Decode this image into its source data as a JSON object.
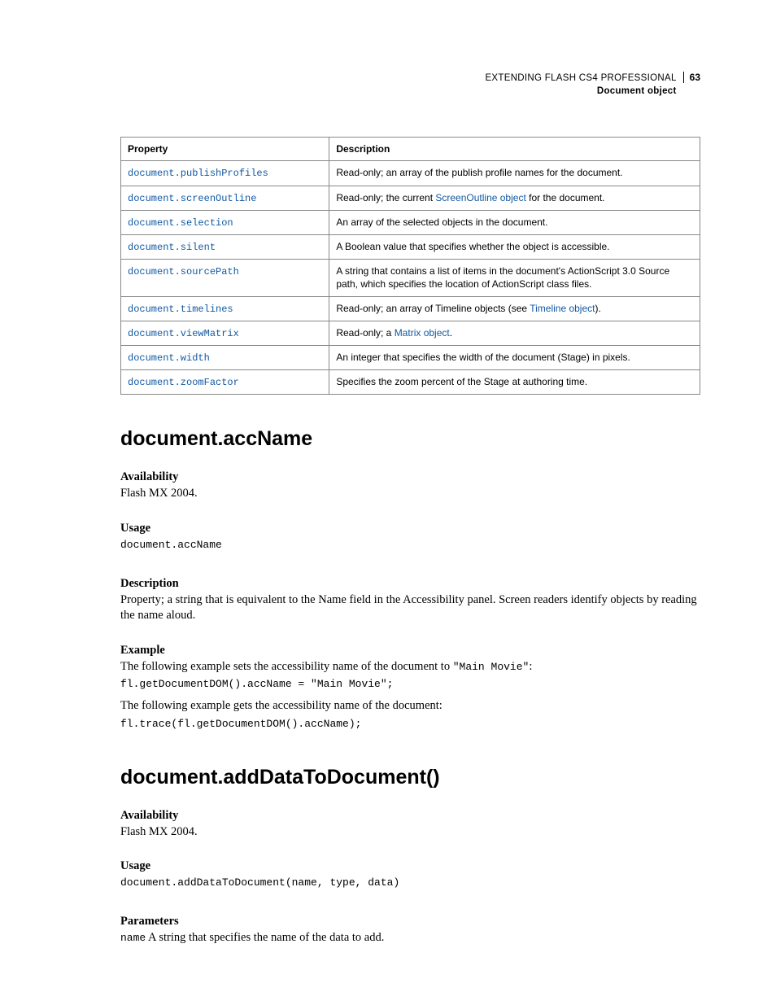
{
  "header": {
    "title": "EXTENDING FLASH CS4 PROFESSIONAL",
    "subtitle": "Document object",
    "page": "63"
  },
  "table": {
    "headers": {
      "property": "Property",
      "description": "Description"
    },
    "rows": [
      {
        "prop": "document.publishProfiles",
        "desc_pre": "Read-only; an array of the publish profile names for the document."
      },
      {
        "prop": "document.screenOutline",
        "desc_pre": "Read-only; the current ",
        "desc_link": "ScreenOutline object",
        "desc_post": " for the document."
      },
      {
        "prop": "document.selection",
        "desc_pre": "An array of the selected objects in the document."
      },
      {
        "prop": "document.silent",
        "desc_pre": "A Boolean value that specifies whether the object is accessible."
      },
      {
        "prop": "document.sourcePath",
        "desc_pre": "A string that contains a list of items in the document's ActionScript 3.0 Source path, which specifies the location of ActionScript class files."
      },
      {
        "prop": "document.timelines",
        "desc_pre": "Read-only; an array of Timeline objects (see ",
        "desc_link": "Timeline object",
        "desc_post": ")."
      },
      {
        "prop": "document.viewMatrix",
        "desc_pre": "Read-only; a ",
        "desc_link": "Matrix object",
        "desc_post": "."
      },
      {
        "prop": "document.width",
        "desc_pre": "An integer that specifies the width of the document (Stage) in pixels."
      },
      {
        "prop": "document.zoomFactor",
        "desc_pre": "Specifies the zoom percent of the Stage at authoring time."
      }
    ]
  },
  "sections": {
    "accName": {
      "heading": "document.accName",
      "availability_h": "Availability",
      "availability": "Flash MX 2004.",
      "usage_h": "Usage",
      "usage_code": "document.accName",
      "description_h": "Description",
      "description": "Property; a string that is equivalent to the Name field in the Accessibility panel. Screen readers identify objects by reading the name aloud.",
      "example_h": "Example",
      "example_p1_pre": "The following example sets the accessibility name of the document to ",
      "example_p1_code": "\"Main Movie\"",
      "example_p1_post": ":",
      "example_code1": "fl.getDocumentDOM().accName = \"Main Movie\";",
      "example_p2": "The following example gets the accessibility name of the document:",
      "example_code2": "fl.trace(fl.getDocumentDOM().accName);"
    },
    "addData": {
      "heading": "document.addDataToDocument()",
      "availability_h": "Availability",
      "availability": "Flash MX 2004.",
      "usage_h": "Usage",
      "usage_code": "document.addDataToDocument(name, type, data)",
      "parameters_h": "Parameters",
      "param_name": "name",
      "param_desc": "  A string that specifies the name of the data to add."
    }
  }
}
